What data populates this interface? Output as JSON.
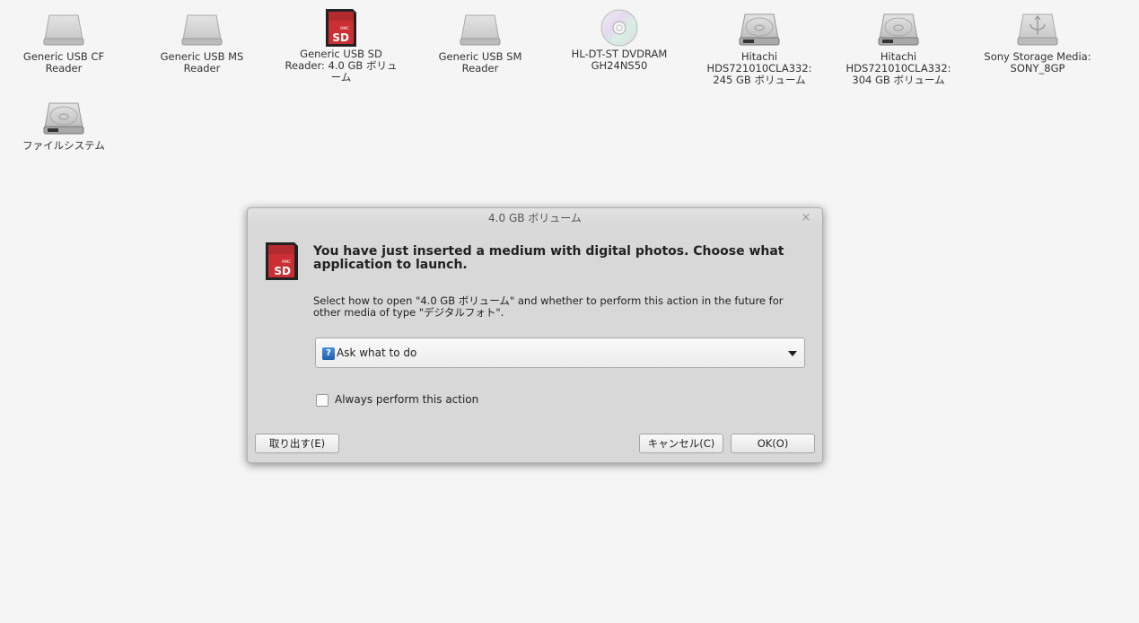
{
  "desktop": {
    "icons": [
      {
        "label": "Generic USB CF Reader",
        "icon": "removable-drive-icon"
      },
      {
        "label": "Generic USB MS Reader",
        "icon": "removable-drive-icon"
      },
      {
        "label": "Generic USB SD Reader: 4.0 GB ボリューム",
        "icon": "sd-card-icon"
      },
      {
        "label": "Generic USB SM Reader",
        "icon": "removable-drive-icon"
      },
      {
        "label": "HL-DT-ST DVDRAM GH24NS50",
        "icon": "optical-disc-icon"
      },
      {
        "label": "Hitachi HDS721010CLA332: 245 GB ボリューム",
        "icon": "hard-disk-icon"
      },
      {
        "label": "Hitachi HDS721010CLA332: 304 GB ボリューム",
        "icon": "hard-disk-icon"
      },
      {
        "label": "Sony Storage Media: SONY_8GP",
        "icon": "usb-drive-icon"
      },
      {
        "label": "ファイルシステム",
        "icon": "hard-disk-icon"
      }
    ]
  },
  "dialog": {
    "title": "4.0 GB ボリューム",
    "close_glyph": "×",
    "icon": "sd-card-icon",
    "heading": "You have just inserted a medium with digital photos. Choose what application to launch.",
    "description": "Select how to open \"4.0 GB ボリューム\" and whether to perform this action in the future for other media of type \"デジタルフォト\".",
    "combo": {
      "selected": "Ask what to do",
      "icon_glyph": "?"
    },
    "checkbox": {
      "label": "Always perform this action",
      "checked": false
    },
    "buttons": {
      "eject": "取り出す(E)",
      "cancel": "キャンセル(C)",
      "ok": "OK(O)"
    }
  },
  "colors": {
    "desktop_bg": "#f5f5f5",
    "dialog_bg": "#d8d8d8",
    "sd_red": "#c8262b"
  }
}
